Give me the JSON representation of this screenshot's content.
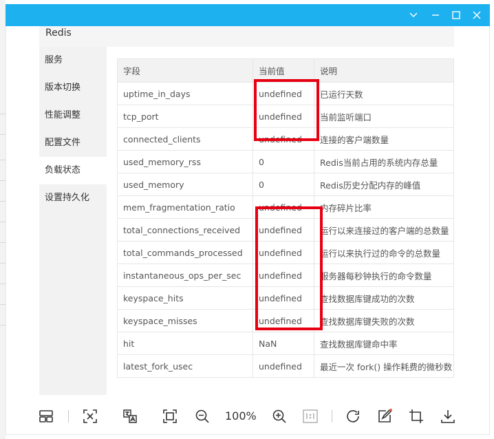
{
  "window": {
    "header_title": "Redis",
    "titlebar_icons": [
      "chevron-down-icon",
      "minimize-icon",
      "maximize-icon",
      "close-icon"
    ]
  },
  "sidebar": {
    "items": [
      {
        "label": "服务"
      },
      {
        "label": "版本切换"
      },
      {
        "label": "性能调整"
      },
      {
        "label": "配置文件"
      },
      {
        "label": "负载状态",
        "active": true
      },
      {
        "label": "设置持久化"
      }
    ]
  },
  "table": {
    "headers": [
      "字段",
      "当前值",
      "说明"
    ],
    "rows": [
      [
        "uptime_in_days",
        "undefined",
        "已运行天数"
      ],
      [
        "tcp_port",
        "undefined",
        "当前监听端口"
      ],
      [
        "connected_clients",
        "undefined",
        "连接的客户端数量"
      ],
      [
        "used_memory_rss",
        "0",
        "Redis当前占用的系统内存总量"
      ],
      [
        "used_memory",
        "0",
        "Redis历史分配内存的峰值"
      ],
      [
        "mem_fragmentation_ratio",
        "undefined",
        "内存碎片比率"
      ],
      [
        "total_connections_received",
        "undefined",
        "运行以来连接过的客户端的总数量"
      ],
      [
        "total_commands_processed",
        "undefined",
        "运行以来执行过的命令的总数量"
      ],
      [
        "instantaneous_ops_per_sec",
        "undefined",
        "服务器每秒钟执行的命令数量"
      ],
      [
        "keyspace_hits",
        "undefined",
        "查找数据库键成功的次数"
      ],
      [
        "keyspace_misses",
        "undefined",
        "查找数据库键失败的次数"
      ],
      [
        "hit",
        "NaN",
        "查找数据库键命中率"
      ],
      [
        "latest_fork_usec",
        "undefined",
        "最近一次 fork() 操作耗费的微秒数"
      ]
    ]
  },
  "toolbar": {
    "zoom_label": "100%",
    "icons": [
      "thumbnails-icon",
      "fit-window-icon",
      "translate-icon",
      "fullscreen-icon",
      "zoom-out-icon",
      "zoom-in-icon",
      "actual-size-icon",
      "rotate-icon",
      "edit-icon",
      "crop-icon",
      "download-icon"
    ]
  },
  "colors": {
    "titlebar": "#1eb1f0",
    "highlight_box": "#e60012",
    "sidebar_bg": "#f2f2f2"
  }
}
